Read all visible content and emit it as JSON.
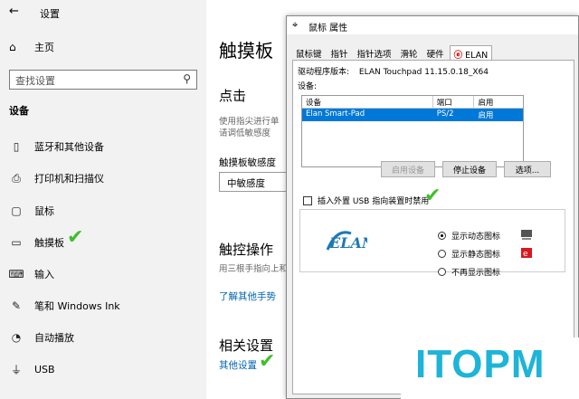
{
  "settings": {
    "window_title": "设置",
    "home_label": "主页",
    "search_placeholder": "查找设置",
    "section": "设备",
    "nav": [
      {
        "label": "蓝牙和其他设备",
        "icon": "bluetooth-icon"
      },
      {
        "label": "打印机和扫描仪",
        "icon": "printer-icon"
      },
      {
        "label": "鼠标",
        "icon": "mouse-icon"
      },
      {
        "label": "触摸板",
        "icon": "touchpad-icon"
      },
      {
        "label": "输入",
        "icon": "keyboard-icon"
      },
      {
        "label": "笔和 Windows Ink",
        "icon": "pen-icon"
      },
      {
        "label": "自动播放",
        "icon": "autoplay-icon"
      },
      {
        "label": "USB",
        "icon": "usb-icon"
      }
    ],
    "main": {
      "title": "触摸板",
      "click_heading": "点击",
      "click_desc_1": "使用指尖进行单",
      "click_desc_2": "请调低敏感度",
      "sensitivity_label": "触摸板敏感度",
      "sensitivity_value": "中敏感度",
      "gesture_heading": "触控操作",
      "gesture_desc": "用三根手指向上和",
      "gesture_link": "了解其他手势",
      "related_heading": "相关设置",
      "related_link": "其他设置"
    }
  },
  "dialog": {
    "title": "鼠标 属性",
    "tabs": [
      "鼠标键",
      "指针",
      "指针选项",
      "滑轮",
      "硬件",
      "ELAN"
    ],
    "active_tab": "ELAN",
    "driver_label": "驱动程序版本:",
    "driver_value": "ELAN Touchpad 11.15.0.18_X64",
    "devices_label": "设备:",
    "columns": [
      "设备",
      "端口",
      "启用"
    ],
    "device_row": [
      "Elan Smart-Pad",
      "PS/2",
      "启用"
    ],
    "buttons": {
      "enable": "启用设备",
      "stop": "停止设备",
      "options": "选项..."
    },
    "checkbox_label": "插入外置 USB 指向装置时禁用",
    "logo_text": "ELAN",
    "radios": [
      {
        "label": "显示动态图标",
        "selected": true
      },
      {
        "label": "显示静态图标",
        "selected": false
      },
      {
        "label": "不再显示图标",
        "selected": false
      }
    ],
    "accent": "#0078d7"
  },
  "watermark": {
    "text": "ITOPM",
    "color": "#1eb4d8"
  }
}
